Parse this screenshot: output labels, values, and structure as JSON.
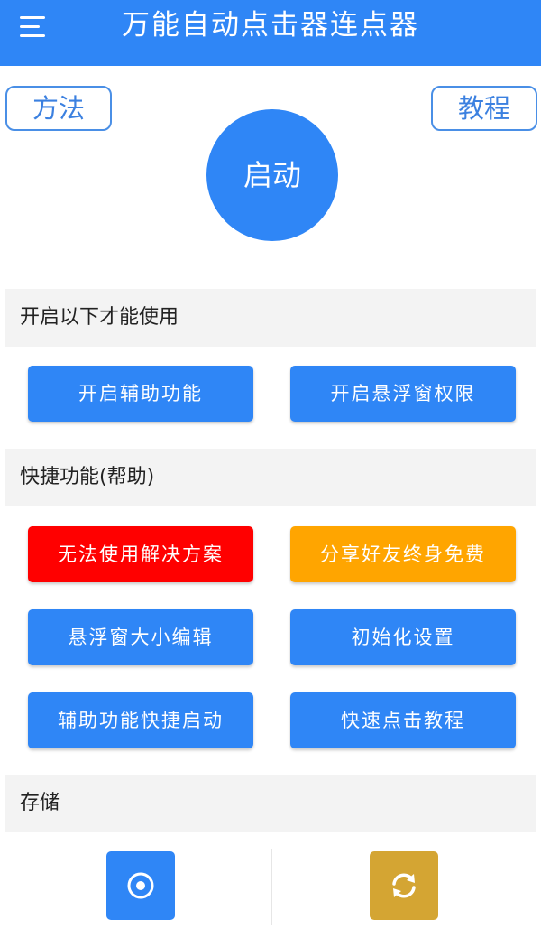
{
  "header": {
    "title": "万能自动点击器连点器",
    "menu_icon": "hamburger-menu-icon"
  },
  "top_buttons": {
    "method": "方法",
    "tutorial": "教程",
    "start": "启动"
  },
  "sections": {
    "permissions": {
      "title": "开启以下才能使用",
      "buttons": [
        "开启辅助功能",
        "开启悬浮窗权限"
      ]
    },
    "shortcuts": {
      "title": "快捷功能(帮助)",
      "buttons": [
        "无法使用解决方案",
        "分享好友终身免费",
        "悬浮窗大小编辑",
        "初始化设置",
        "辅助功能快捷启动",
        "快速点击教程"
      ]
    },
    "storage": {
      "title": "存储",
      "icons": [
        "target-circle-icon",
        "sync-refresh-icon"
      ]
    }
  },
  "colors": {
    "primary": "#2f86f6",
    "danger": "#ff0000",
    "warning": "#ffa500",
    "gold": "#d4a533",
    "section_bg": "#f3f3f3"
  }
}
